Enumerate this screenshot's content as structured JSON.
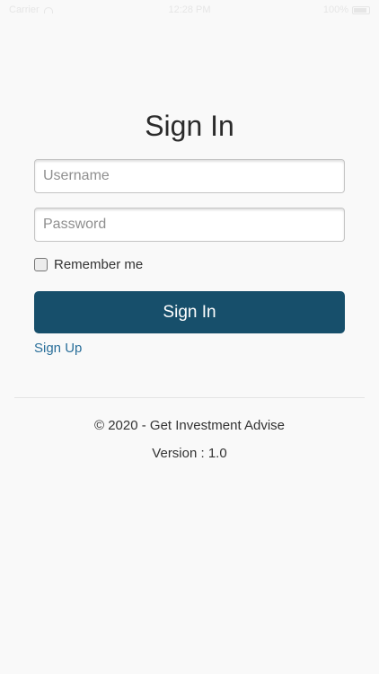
{
  "status_bar": {
    "carrier": "Carrier",
    "time": "12:28 PM",
    "battery": "100%"
  },
  "signin": {
    "title": "Sign In",
    "username_placeholder": "Username",
    "password_placeholder": "Password",
    "username_value": "",
    "password_value": "",
    "remember_label": "Remember me",
    "remember_checked": false,
    "button_label": "Sign In",
    "signup_label": "Sign Up"
  },
  "footer": {
    "copyright": "© 2020 - Get Investment Advise",
    "version": "Version : 1.0"
  },
  "colors": {
    "primary_button": "#174f6b",
    "link": "#2a6f9a",
    "background": "#f9f9f9"
  }
}
